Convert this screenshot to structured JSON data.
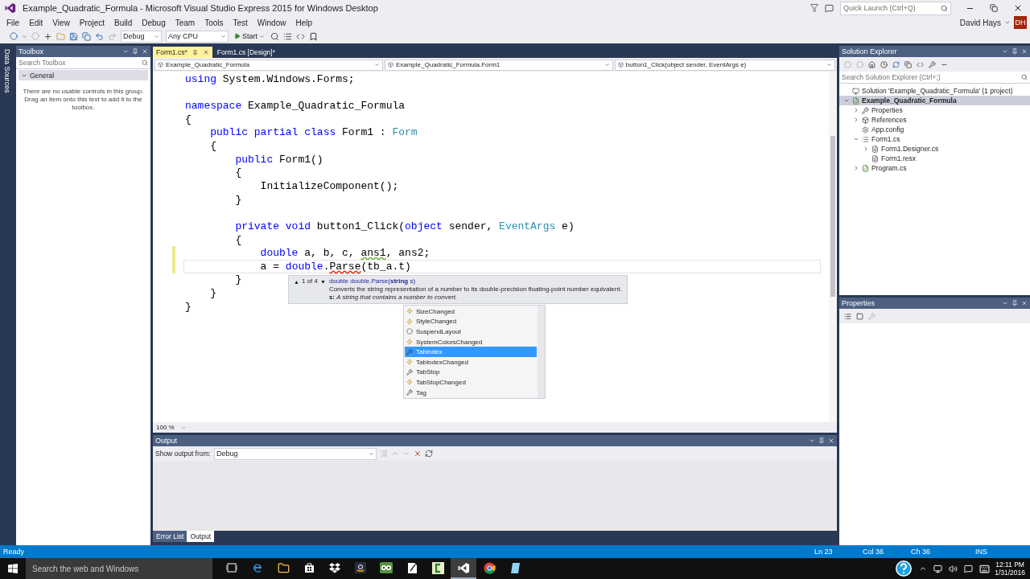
{
  "window": {
    "title": "Example_Quadratic_Formula - Microsoft Visual Studio Express 2015 for Windows Desktop"
  },
  "quick_launch": {
    "placeholder": "Quick Launch (Ctrl+Q)"
  },
  "menu": [
    "File",
    "Edit",
    "View",
    "Project",
    "Build",
    "Debug",
    "Team",
    "Tools",
    "Test",
    "Window",
    "Help"
  ],
  "account": {
    "name": "David Hays",
    "initials": "DH"
  },
  "toolbar": {
    "configuration": "Debug",
    "platform": "Any CPU",
    "start": "Start"
  },
  "side_strip": {
    "label": "Data Sources"
  },
  "toolbox": {
    "title": "Toolbox",
    "search_placeholder": "Search Toolbox",
    "group": {
      "label": "General",
      "expanded": true
    },
    "message": "There are no usable controls in this group. Drag an item onto this text to add it to the toolbox."
  },
  "editor": {
    "tabs": [
      {
        "label": "Form1.cs*",
        "selected": true
      },
      {
        "label": "Form1.cs [Design]*",
        "selected": false
      }
    ],
    "nav": [
      "Example_Quadratic_Formula",
      "Example_Quadratic_Formula.Form1",
      "button1_Click(object sender, EventArgs e)"
    ],
    "lines": [
      {
        "tokens": [
          {
            "kind": "keyword",
            "text": "using"
          },
          {
            "kind": "plain",
            "text": " System.Windows.Forms;"
          }
        ],
        "current": false,
        "changed": false
      },
      {
        "current": false,
        "changed": false
      },
      {
        "tokens": [
          {
            "kind": "keyword",
            "text": "namespace"
          },
          {
            "kind": "plain",
            "text": " Example_Quadratic_Formula"
          }
        ],
        "current": false,
        "changed": false
      },
      {
        "tokens": [
          {
            "kind": "plain",
            "text": "{"
          }
        ],
        "current": false,
        "changed": false
      },
      {
        "tokens": [
          {
            "kind": "keyword",
            "text": "    public partial class"
          },
          {
            "kind": "plain",
            "text": " Form1 : "
          },
          {
            "kind": "type",
            "text": "Form"
          }
        ],
        "current": false,
        "changed": false
      },
      {
        "tokens": [
          {
            "kind": "plain",
            "text": "    {"
          }
        ],
        "current": false,
        "changed": false
      },
      {
        "tokens": [
          {
            "kind": "keyword",
            "text": "        public"
          },
          {
            "kind": "plain",
            "text": " Form1()"
          }
        ],
        "current": false,
        "changed": false
      },
      {
        "tokens": [
          {
            "kind": "plain",
            "text": "        {"
          }
        ],
        "current": false,
        "changed": false
      },
      {
        "tokens": [
          {
            "kind": "plain",
            "text": "            InitializeComponent();"
          }
        ],
        "current": false,
        "changed": false
      },
      {
        "tokens": [
          {
            "kind": "plain",
            "text": "        }"
          }
        ],
        "current": false,
        "changed": false
      },
      {
        "current": false,
        "changed": false
      },
      {
        "tokens": [
          {
            "kind": "keyword",
            "text": "        private void"
          },
          {
            "kind": "plain",
            "text": " button1_Click("
          },
          {
            "kind": "keyword",
            "text": "object"
          },
          {
            "kind": "plain",
            "text": " sender, "
          },
          {
            "kind": "type",
            "text": "EventArgs"
          },
          {
            "kind": "plain",
            "text": " e)"
          }
        ],
        "current": false,
        "changed": false
      },
      {
        "tokens": [
          {
            "kind": "plain",
            "text": "        {"
          }
        ],
        "current": false,
        "changed": false
      },
      {
        "tokens": [
          {
            "kind": "keyword",
            "text": "            double"
          },
          {
            "kind": "plain",
            "text": " a, b, c, "
          },
          {
            "kind": "warning",
            "text": "ans1"
          },
          {
            "kind": "plain",
            "text": ", ans2;"
          }
        ],
        "current": false,
        "changed": true
      },
      {
        "tokens": [
          {
            "kind": "plain",
            "text": "            a = "
          },
          {
            "kind": "keyword",
            "text": "double"
          },
          {
            "kind": "plain",
            "text": "."
          },
          {
            "kind": "error",
            "text": "Parse"
          },
          {
            "kind": "plain",
            "text": "(tb_a.t)"
          }
        ],
        "current": true,
        "changed": true
      },
      {
        "tokens": [
          {
            "kind": "plain",
            "text": "        }"
          }
        ],
        "current": false,
        "changed": false
      },
      {
        "tokens": [
          {
            "kind": "plain",
            "text": "    }"
          }
        ],
        "current": false,
        "changed": false
      },
      {
        "tokens": [
          {
            "kind": "plain",
            "text": "}"
          }
        ],
        "current": false,
        "changed": false
      }
    ],
    "signature_help": {
      "up": "▲",
      "counter": "1 of 4",
      "down": "▼",
      "signature": "double double.Parse(**string** s)",
      "description": "Converts the string representation of a number to its double-precision floating-point number equivalent.",
      "param": "**s:** *A string that contains a number to convert.*"
    },
    "completion": [
      {
        "label": "SizeChanged",
        "kind": "event",
        "selected": false
      },
      {
        "label": "StyleChanged",
        "kind": "event",
        "selected": false
      },
      {
        "label": "SuspendLayout",
        "kind": "method",
        "selected": false
      },
      {
        "label": "SystemColorsChanged",
        "kind": "event",
        "selected": false
      },
      {
        "label": "TabIndex",
        "kind": "property",
        "selected": true
      },
      {
        "label": "TabIndexChanged",
        "kind": "event",
        "selected": false
      },
      {
        "label": "TabStop",
        "kind": "property",
        "selected": false
      },
      {
        "label": "TabStopChanged",
        "kind": "event",
        "selected": false
      },
      {
        "label": "Tag",
        "kind": "property",
        "selected": false
      }
    ],
    "zoom": "100 %"
  },
  "output": {
    "title": "Output",
    "source_label": "Show output from:",
    "source": "Debug",
    "tabs": [
      {
        "label": "Error List",
        "selected": false
      },
      {
        "label": "Output",
        "selected": true
      }
    ]
  },
  "solution_explorer": {
    "title": "Solution Explorer",
    "search_placeholder": "Search Solution Explorer (Ctrl+;)",
    "tree": [
      {
        "label": "Solution 'Example_Quadratic_Formula' (1 project)",
        "kind": "solution",
        "selected": false
      },
      {
        "label": "Example_Quadratic_Formula",
        "kind": "project",
        "selected": true,
        "expanded": true,
        "children": [
          {
            "label": "Properties",
            "kind": "properties",
            "selected": false,
            "expanded": false
          },
          {
            "label": "References",
            "kind": "references",
            "selected": false,
            "expanded": false
          },
          {
            "label": "App.config",
            "kind": "config",
            "selected": false
          },
          {
            "label": "Form1.cs",
            "kind": "form",
            "selected": false,
            "expanded": true,
            "children": [
              {
                "label": "Form1.Designer.cs",
                "kind": "file",
                "selected": false,
                "expanded": false
              },
              {
                "label": "Form1.resx",
                "kind": "file",
                "selected": false
              }
            ]
          },
          {
            "label": "Program.cs",
            "kind": "csharp",
            "selected": false,
            "expanded": false
          }
        ]
      }
    ]
  },
  "properties": {
    "title": "Properties"
  },
  "status": {
    "text": "Ready",
    "line": "Ln 23",
    "col": "Col 36",
    "ch": "Ch 36",
    "mode": "INS"
  },
  "taskbar": {
    "search_placeholder": "Search the web and Windows",
    "apps": [
      {
        "kind": "taskview",
        "selected": false
      },
      {
        "kind": "browser",
        "selected": false
      },
      {
        "kind": "folder",
        "selected": false
      },
      {
        "kind": "store",
        "selected": false
      },
      {
        "kind": "dropbox",
        "selected": false
      },
      {
        "kind": "shop",
        "selected": false
      },
      {
        "kind": "owl",
        "selected": false
      },
      {
        "kind": "notes",
        "selected": false
      },
      {
        "kind": "recorder",
        "selected": false
      },
      {
        "kind": "vs",
        "selected": true
      },
      {
        "kind": "chrome",
        "selected": false
      },
      {
        "kind": "file",
        "selected": false
      }
    ],
    "time": "12:11 PM",
    "date": "1/31/2016"
  }
}
